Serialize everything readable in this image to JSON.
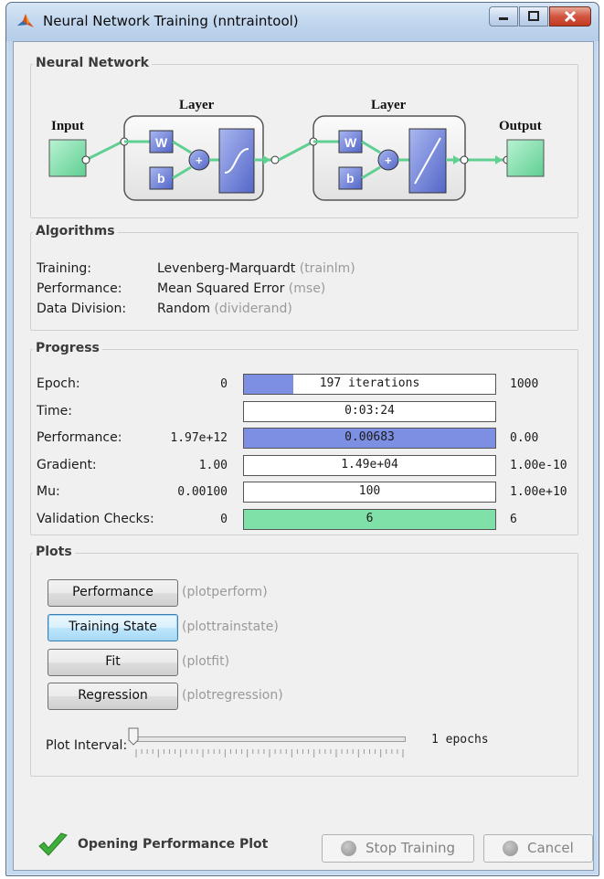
{
  "window": {
    "title": "Neural Network Training (nntraintool)"
  },
  "neural_network": {
    "group_title": "Neural Network",
    "input_label": "Input",
    "output_label": "Output",
    "layers": [
      {
        "title": "Layer",
        "w_label": "W",
        "b_label": "b",
        "sum_label": "+",
        "transfer": "tansig"
      },
      {
        "title": "Layer",
        "w_label": "W",
        "b_label": "b",
        "sum_label": "+",
        "transfer": "purelin"
      }
    ]
  },
  "algorithms": {
    "group_title": "Algorithms",
    "rows": [
      {
        "label": "Training:",
        "value": "Levenberg-Marquardt",
        "func": "(trainlm)"
      },
      {
        "label": "Performance:",
        "value": "Mean Squared Error",
        "func": "(mse)"
      },
      {
        "label": "Data Division:",
        "value": "Random",
        "func": "(dividerand)"
      }
    ]
  },
  "progress": {
    "group_title": "Progress",
    "rows": [
      {
        "label": "Epoch:",
        "min": "0",
        "text": "197 iterations",
        "max": "1000",
        "fill": 0.197,
        "color": "#7c8fe2"
      },
      {
        "label": "Time:",
        "min": "",
        "text": "0:03:24",
        "max": "",
        "fill": 0,
        "color": "#7c8fe2"
      },
      {
        "label": "Performance:",
        "min": "1.97e+12",
        "text": "0.00683",
        "max": "0.00",
        "fill": 1.0,
        "color": "#7c8fe2"
      },
      {
        "label": "Gradient:",
        "min": "1.00",
        "text": "1.49e+04",
        "max": "1.00e-10",
        "fill": 0,
        "color": "#7c8fe2"
      },
      {
        "label": "Mu:",
        "min": "0.00100",
        "text": "100",
        "max": "1.00e+10",
        "fill": 0,
        "color": "#7c8fe2"
      },
      {
        "label": "Validation Checks:",
        "min": "0",
        "text": "6",
        "max": "6",
        "fill": 1.0,
        "color": "#7fe0a8"
      }
    ]
  },
  "plots": {
    "group_title": "Plots",
    "buttons": [
      {
        "label": "Performance",
        "func": "(plotperform)"
      },
      {
        "label": "Training State",
        "func": "(plottrainstate)"
      },
      {
        "label": "Fit",
        "func": "(plotfit)"
      },
      {
        "label": "Regression",
        "func": "(plotregression)"
      }
    ],
    "interval_label": "Plot Interval:",
    "interval_value": "1 epochs",
    "interval_fraction": 0
  },
  "status": {
    "icon": "check-icon",
    "text": "Opening Performance Plot"
  },
  "footer": {
    "stop_label": "Stop Training",
    "cancel_label": "Cancel"
  },
  "colors": {
    "nn_block": "#7fe0a8",
    "nn_weight": "#7287d8",
    "progress_fill": "#7c8fe2",
    "validation_fill": "#7fe0a8"
  }
}
